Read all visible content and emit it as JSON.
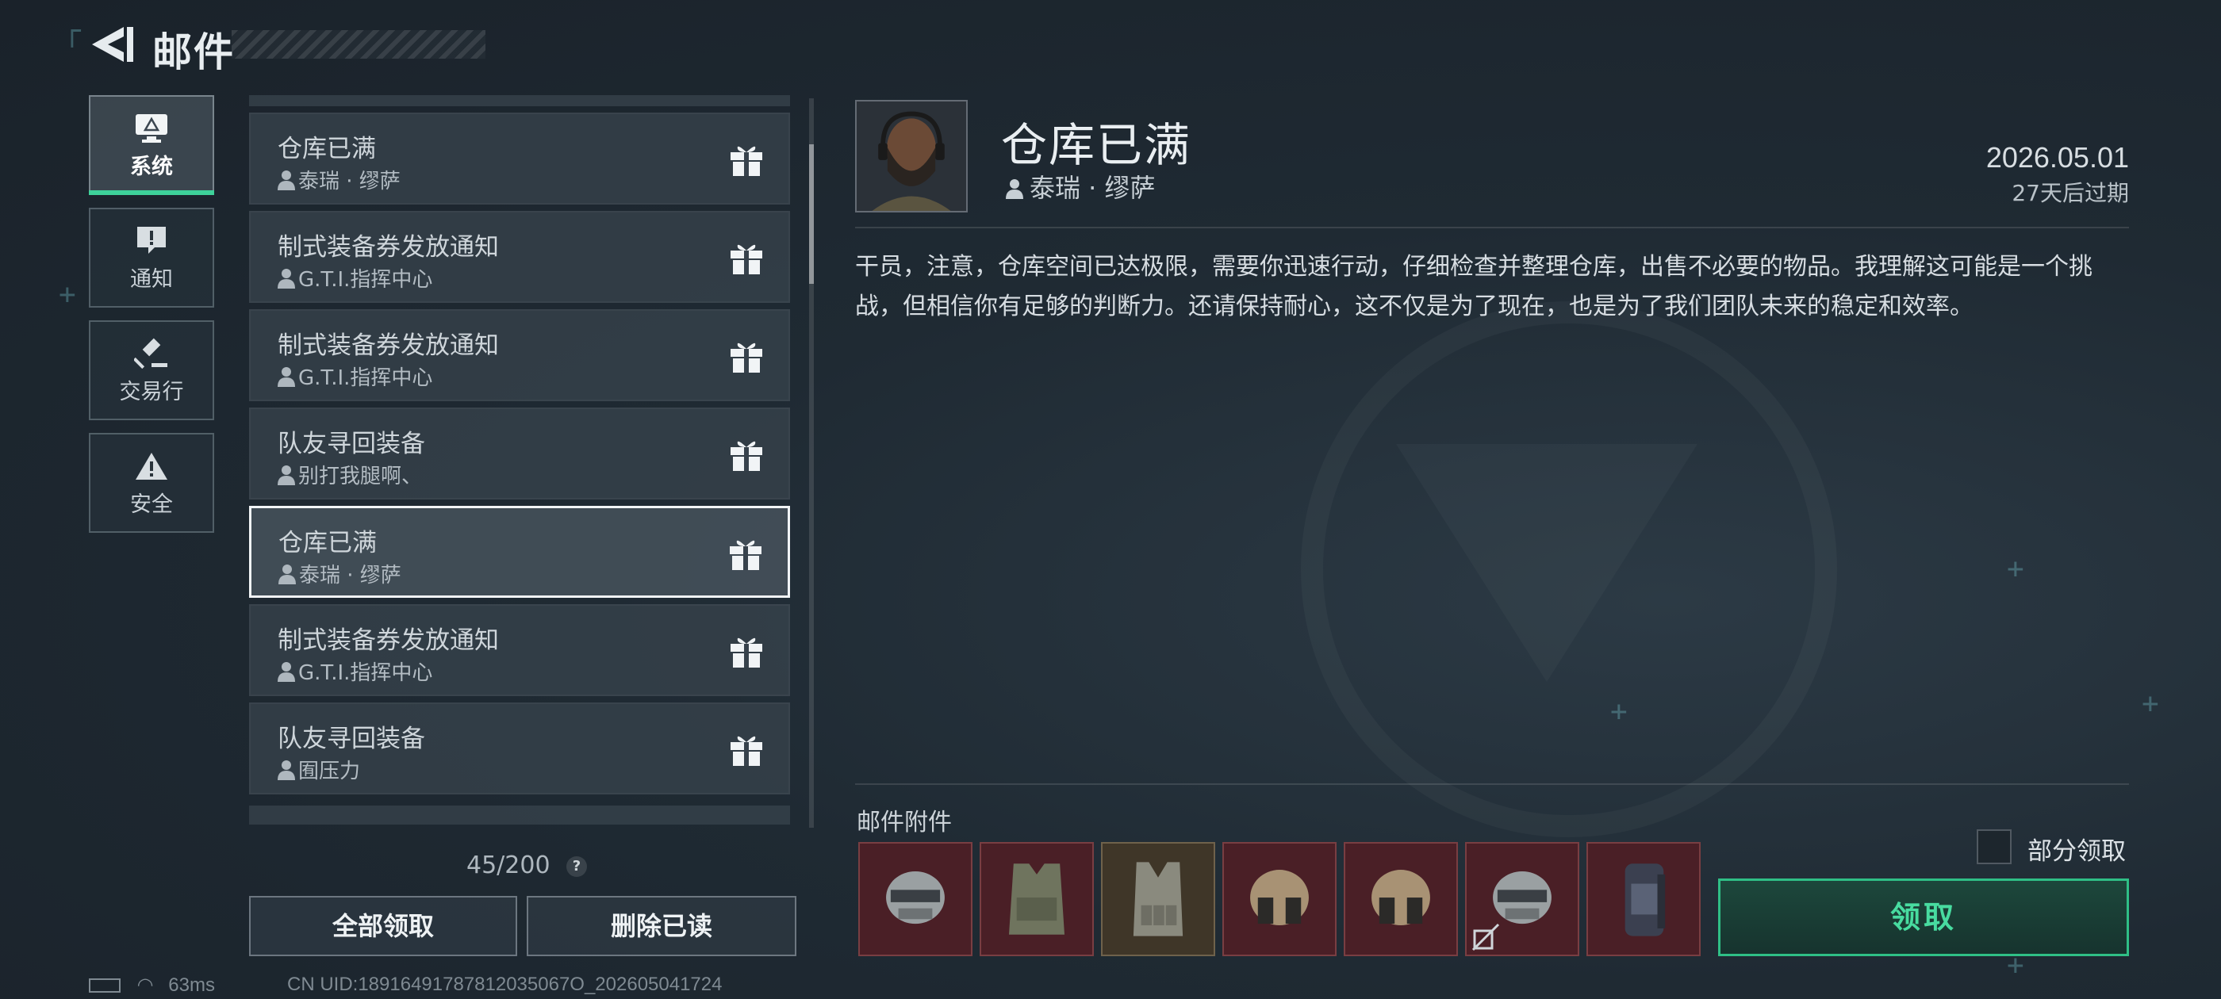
{
  "header": {
    "title": "邮件",
    "back_icon": "back-arrow-icon"
  },
  "categories": [
    {
      "label": "系统",
      "icon": "monitor-icon",
      "active": true
    },
    {
      "label": "通知",
      "icon": "exclamation-bubble-icon",
      "active": false
    },
    {
      "label": "交易行",
      "icon": "gavel-icon",
      "active": false
    },
    {
      "label": "安全",
      "icon": "warning-triangle-icon",
      "active": false
    }
  ],
  "mail_list": {
    "items": [
      {
        "subject": "仓库已满",
        "sender": "泰瑞 · 缪萨",
        "selected": false
      },
      {
        "subject": "制式装备券发放通知",
        "sender": "G.T.I.指挥中心",
        "selected": false
      },
      {
        "subject": "制式装备券发放通知",
        "sender": "G.T.I.指挥中心",
        "selected": false
      },
      {
        "subject": "队友寻回装备",
        "sender": "别打我腿啊、",
        "selected": false
      },
      {
        "subject": "仓库已满",
        "sender": "泰瑞 · 缪萨",
        "selected": true
      },
      {
        "subject": "制式装备券发放通知",
        "sender": "G.T.I.指挥中心",
        "selected": false
      },
      {
        "subject": "队友寻回装备",
        "sender": "囿压力",
        "selected": false
      }
    ],
    "count": "45/200",
    "help_label": "?",
    "claim_all_label": "全部领取",
    "delete_read_label": "删除已读"
  },
  "detail": {
    "subject": "仓库已满",
    "sender": "泰瑞 · 缪萨",
    "date": "2026.05.01",
    "expire": "27天后过期",
    "body": "干员，注意，仓库空间已达极限，需要你迅速行动，仔细检查并整理仓库，出售不必要的物品。我理解这可能是一个挑战，但相信你有足够的判断力。还请保持耐心，这不仅是为了现在，也是为了我们团队未来的稳定和效率。",
    "attachments_label": "邮件附件",
    "attachments": [
      {
        "icon": "helmet-icon",
        "rarity": "red"
      },
      {
        "icon": "body-armor-icon",
        "rarity": "red"
      },
      {
        "icon": "chest-rig-icon",
        "rarity": "tan"
      },
      {
        "icon": "tan-helmet-icon",
        "rarity": "red"
      },
      {
        "icon": "tan-helmet-icon",
        "rarity": "red"
      },
      {
        "icon": "helmet-icon",
        "rarity": "red",
        "locked": true
      },
      {
        "icon": "backpack-icon",
        "rarity": "red"
      }
    ],
    "partial_claim_label": "部分领取",
    "claim_label": "领取"
  },
  "status_bar": {
    "ping": "63ms",
    "uid": "CN UID:18916491787812035067O_202605041724"
  },
  "colors": {
    "accent_green": "#3ed29a",
    "item_red_bg": "#4a1f26",
    "item_tan_bg": "#3f3628"
  }
}
